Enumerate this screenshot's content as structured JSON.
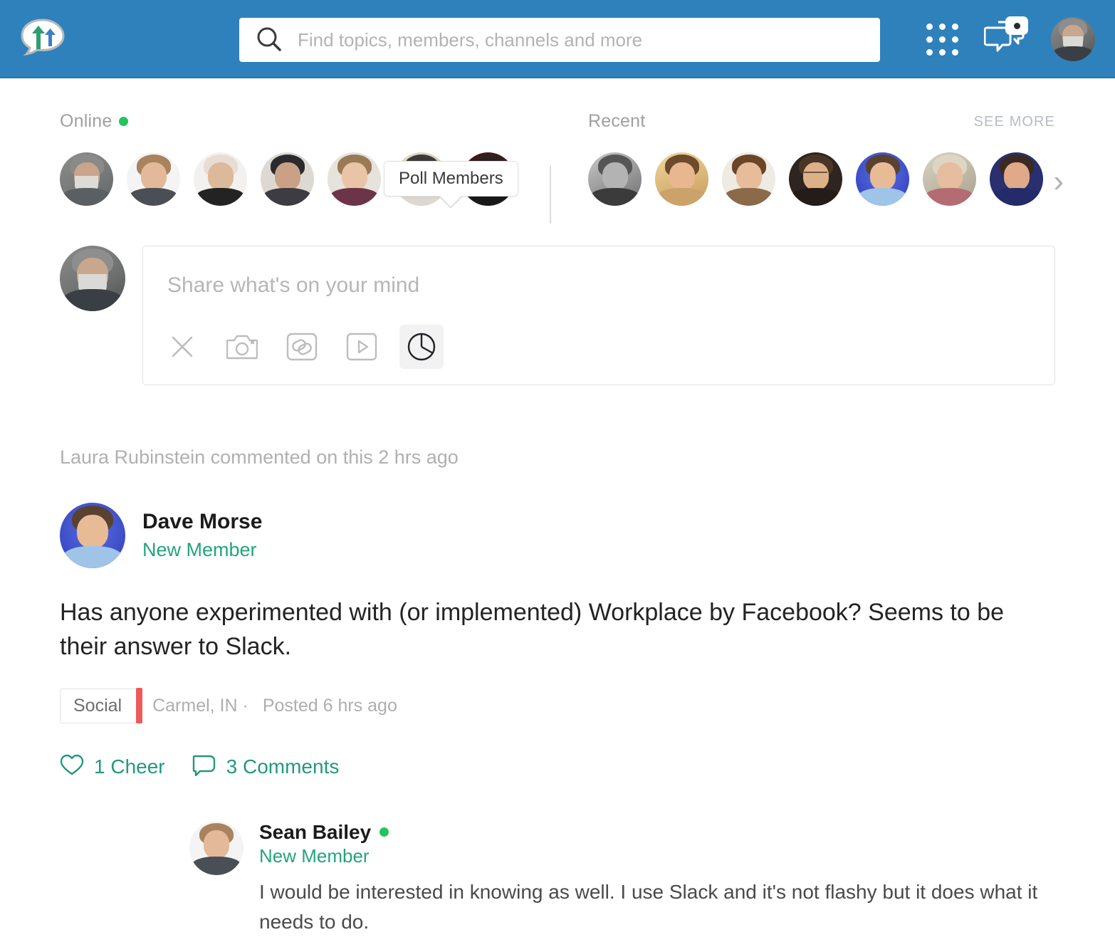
{
  "header": {
    "logo_name": "speech-bubble-arrows-logo",
    "search": {
      "placeholder": "Find topics, members, channels and more",
      "value": ""
    },
    "apps_icon": "apps-grid-icon",
    "messages_icon": "chat-bubbles-icon",
    "messages_badge": "•",
    "profile_avatar": "user-avatar",
    "brand_color": "#2f81bc"
  },
  "people": {
    "online": {
      "label": "Online",
      "status_color": "#22c55e",
      "avatars": [
        {
          "name": "online-avatar-1"
        },
        {
          "name": "online-avatar-2"
        },
        {
          "name": "online-avatar-3"
        },
        {
          "name": "online-avatar-4"
        },
        {
          "name": "online-avatar-5"
        },
        {
          "name": "online-avatar-6"
        },
        {
          "name": "online-avatar-7"
        }
      ]
    },
    "recent": {
      "label": "Recent",
      "see_more": "SEE MORE",
      "next_icon": "chevron-right-icon",
      "avatars": [
        {
          "name": "recent-avatar-1"
        },
        {
          "name": "recent-avatar-2"
        },
        {
          "name": "recent-avatar-3"
        },
        {
          "name": "recent-avatar-4"
        },
        {
          "name": "recent-avatar-5"
        },
        {
          "name": "recent-avatar-6"
        },
        {
          "name": "recent-avatar-7"
        }
      ]
    }
  },
  "composer": {
    "placeholder": "Share what's on your mind",
    "value": "",
    "tooltip": "Poll Members",
    "tools": [
      {
        "name": "close-icon",
        "label": "Close"
      },
      {
        "name": "camera-icon",
        "label": "Add Photo"
      },
      {
        "name": "link-icon",
        "label": "Add Link"
      },
      {
        "name": "video-icon",
        "label": "Add Video"
      },
      {
        "name": "pie-chart-icon",
        "label": "Poll Members"
      }
    ]
  },
  "feed": {
    "activity": "Laura Rubinstein commented on this 2 hrs ago",
    "post": {
      "author": "Dave Morse",
      "role": "New Member",
      "body": "Has anyone experimented with (or implemented) Workplace by Facebook? Seems to be their answer to Slack.",
      "tag": "Social",
      "tag_color": "#ee5a5a",
      "location": "Carmel, IN ·",
      "posted": "Posted 6 hrs ago",
      "cheers": "1 Cheer",
      "comments": "3 Comments",
      "accent_color": "#23987e"
    },
    "comments": [
      {
        "author": "Sean Bailey",
        "online": true,
        "role": "New Member",
        "text": "I would be interested in knowing as well. I use Slack and it's not flashy but it does what it needs to do."
      }
    ]
  }
}
